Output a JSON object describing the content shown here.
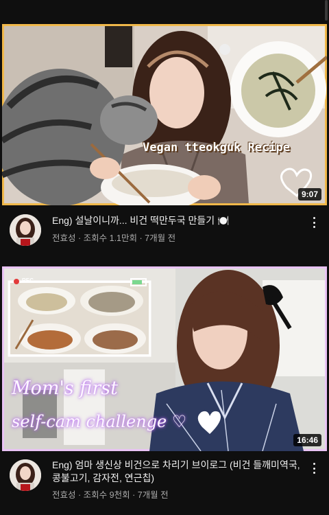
{
  "videos": [
    {
      "overlay_text": "Vegan tteokguk Recipe",
      "duration": "9:07",
      "title": "Eng) 설날이니까... 비건 떡만두국 만들기 🍽️",
      "channel": "전효성",
      "views": "조회수 1.1만회",
      "age": "7개월 전",
      "separator": "·"
    },
    {
      "overlay_text_line1": "Mom's first",
      "overlay_text_line2": "self-cam challenge ♡",
      "rec_label": "REC",
      "duration": "16:46",
      "title": "Eng) 엄마 생신상 비건으로 차리기 브이로그 (비건 들깨미역국, 콩불고기, 감자전, 연근칩)",
      "channel": "전효성",
      "views": "조회수 9천회",
      "age": "7개월 전",
      "separator": "·"
    }
  ],
  "colors": {
    "background": "#0f0f0f",
    "thumb1_border": "#f0b84a",
    "thumb2_border": "#e9c3f5",
    "secondary_text": "#aaaaaa"
  }
}
